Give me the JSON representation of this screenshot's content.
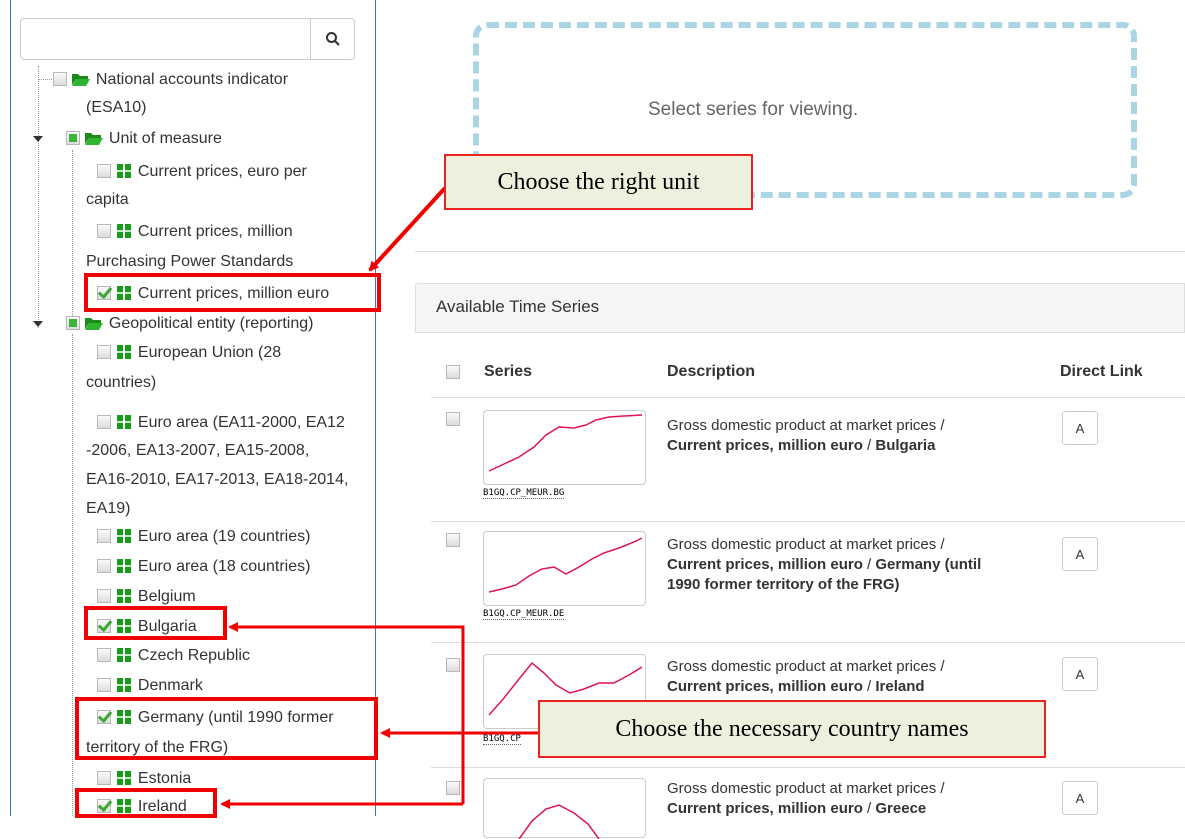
{
  "tree": {
    "search_placeholder": "",
    "items": [
      {
        "label_line1": "National accounts indicator",
        "label_line2": "(ESA10)",
        "state": "unchecked",
        "icon": "folder-open-icon"
      },
      {
        "label_line1": "Unit of measure",
        "state": "partial",
        "icon": "folder-open-icon"
      },
      {
        "label_line1": "Current prices, euro per",
        "label_line2": "capita",
        "state": "unchecked",
        "icon": "series-icon"
      },
      {
        "label_line1": "Current prices, million",
        "label_line2": "Purchasing Power Standards",
        "state": "unchecked",
        "icon": "series-icon"
      },
      {
        "label_line1": "Current prices, million euro",
        "state": "checked",
        "icon": "series-icon"
      },
      {
        "label_line1": "Geopolitical entity (reporting)",
        "state": "partial",
        "icon": "folder-open-icon"
      },
      {
        "label_line1": "European Union (28",
        "label_line2": "countries)",
        "state": "unchecked",
        "icon": "series-icon"
      },
      {
        "label_line1": "Euro area (EA11-2000, EA12",
        "label_line2": "-2006, EA13-2007, EA15-2008,",
        "label_line3": "EA16-2010, EA17-2013, EA18-2014,",
        "label_line4": "EA19)",
        "state": "unchecked",
        "icon": "series-icon"
      },
      {
        "label_line1": "Euro area (19 countries)",
        "state": "unchecked",
        "icon": "series-icon"
      },
      {
        "label_line1": "Euro area (18 countries)",
        "state": "unchecked",
        "icon": "series-icon"
      },
      {
        "label_line1": "Belgium",
        "state": "unchecked",
        "icon": "series-icon"
      },
      {
        "label_line1": "Bulgaria",
        "state": "checked",
        "icon": "series-icon"
      },
      {
        "label_line1": "Czech Republic",
        "state": "unchecked",
        "icon": "series-icon"
      },
      {
        "label_line1": "Denmark",
        "state": "unchecked",
        "icon": "series-icon"
      },
      {
        "label_line1": "Germany (until 1990 former",
        "label_line2": "territory of the FRG)",
        "state": "checked",
        "icon": "series-icon"
      },
      {
        "label_line1": "Estonia",
        "state": "unchecked",
        "icon": "series-icon"
      },
      {
        "label_line1": "Ireland",
        "state": "checked",
        "icon": "series-icon"
      }
    ]
  },
  "viewer": {
    "empty_message": "Select series for viewing."
  },
  "available": {
    "title": "Available Time Series",
    "columns": {
      "series": "Series",
      "description": "Description",
      "direct_link": "Direct Link"
    },
    "rows": [
      {
        "code": "B1GQ.CP_MEUR.BG",
        "desc_plain": "Gross domestic product at market prices /",
        "desc_bold": "Current prices, million euro",
        "desc_tail": " / ",
        "desc_bold2": "Bulgaria",
        "link": "A"
      },
      {
        "code": "B1GQ.CP_MEUR.DE",
        "desc_plain": "Gross domestic product at market prices /",
        "desc_bold": "Current prices, million euro",
        "desc_tail": " / ",
        "desc_bold2": "Germany (until",
        "desc_line3": "1990 former territory of the FRG)",
        "link": "A"
      },
      {
        "code": "B1GQ.CP",
        "desc_plain": "Gross domestic product at market prices /",
        "desc_bold": "Current prices, million euro",
        "desc_tail": " / ",
        "desc_bold2": "Ireland",
        "link": "A"
      },
      {
        "code": "",
        "desc_plain": "Gross domestic product at market prices /",
        "desc_bold": "Current prices, million euro",
        "desc_tail": " / ",
        "desc_bold2": "Greece",
        "link": "A"
      }
    ]
  },
  "annotations": {
    "unit": "Choose the right unit",
    "countries": "Choose the necessary country names"
  },
  "colors": {
    "highlight": "#f20000",
    "callout_bg": "#eef0dd",
    "sparkline": "#e0115f",
    "dash": "#a9d5e4"
  }
}
